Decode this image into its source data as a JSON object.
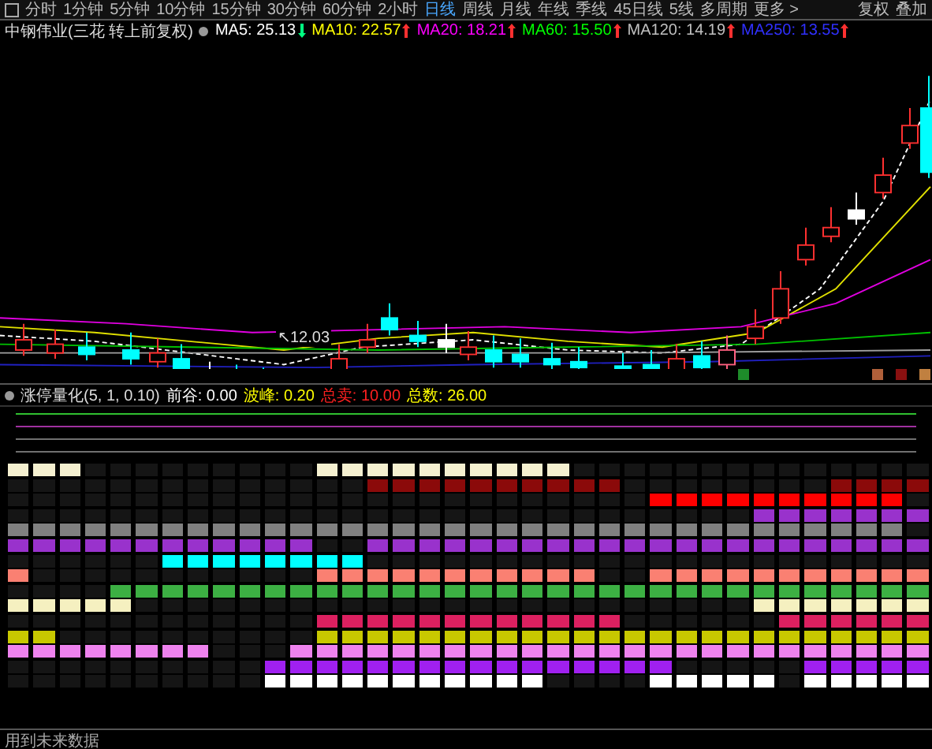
{
  "toolbar": {
    "tabs": [
      {
        "label": "分时",
        "selected": false
      },
      {
        "label": "1分钟",
        "selected": false
      },
      {
        "label": "5分钟",
        "selected": false
      },
      {
        "label": "10分钟",
        "selected": false
      },
      {
        "label": "15分钟",
        "selected": false
      },
      {
        "label": "30分钟",
        "selected": false
      },
      {
        "label": "60分钟",
        "selected": false
      },
      {
        "label": "2小时",
        "selected": false
      },
      {
        "label": "日线",
        "selected": true
      },
      {
        "label": "周线",
        "selected": false
      },
      {
        "label": "月线",
        "selected": false
      },
      {
        "label": "年线",
        "selected": false
      },
      {
        "label": "季线",
        "selected": false
      },
      {
        "label": "45日线",
        "selected": false
      },
      {
        "label": "5线",
        "selected": false
      },
      {
        "label": "多周期",
        "selected": false
      },
      {
        "label": "更多 >",
        "selected": false
      }
    ],
    "right_buttons": [
      "复权",
      "叠加"
    ]
  },
  "main_chart": {
    "title": "中钢伟业(三花 转上前复权)",
    "legend": [
      {
        "text": "MA5: 25.13",
        "color": "#ffffff",
        "arrow": {
          "kind": "down",
          "color": "#00ff80"
        }
      },
      {
        "text": "MA10: 22.57",
        "color": "#ffff00",
        "arrow": {
          "kind": "up",
          "color": "#ff3030"
        }
      },
      {
        "text": "MA20: 18.21",
        "color": "#ff00ff",
        "arrow": {
          "kind": "up",
          "color": "#ff3030"
        }
      },
      {
        "text": "MA60: 15.50",
        "color": "#00ff00",
        "arrow": {
          "kind": "up",
          "color": "#ff3030"
        }
      },
      {
        "text": "MA120: 14.19",
        "color": "#c0c0c0",
        "arrow": {
          "kind": "up",
          "color": "#ff3030"
        }
      },
      {
        "text": "MA250: 13.55",
        "color": "#3030ff",
        "arrow": {
          "kind": "up",
          "color": "#ff3030"
        }
      }
    ],
    "low_label": "↖12.03"
  },
  "indicator": {
    "title": "涨停量化(5, 1, 0.10)",
    "values": [
      {
        "text": "前谷: 0.00",
        "color": "#ffffff"
      },
      {
        "text": "波峰: 0.20",
        "color": "#ffff00"
      },
      {
        "text": "总卖: 10.00",
        "color": "#ff2020"
      },
      {
        "text": "总数: 26.00",
        "color": "#ffff00"
      }
    ],
    "rows": [
      {
        "color": "#f5f0d0",
        "cells": [
          true,
          true,
          true,
          false,
          false,
          false,
          false,
          false,
          false,
          false,
          false,
          false,
          true,
          true,
          true,
          true,
          true,
          true,
          true,
          true,
          true,
          true,
          false,
          false,
          false,
          false,
          false,
          false,
          false,
          false,
          false,
          false,
          false,
          false,
          false,
          false
        ]
      },
      {
        "color": "#8b0a0a",
        "cells": [
          false,
          false,
          false,
          false,
          false,
          false,
          false,
          false,
          false,
          false,
          false,
          false,
          false,
          false,
          true,
          true,
          true,
          true,
          true,
          true,
          true,
          true,
          true,
          true,
          false,
          false,
          false,
          false,
          false,
          false,
          false,
          false,
          true,
          true,
          true,
          true
        ]
      },
      {
        "color": "#ff0000",
        "cells": [
          false,
          false,
          false,
          false,
          false,
          false,
          false,
          false,
          false,
          false,
          false,
          false,
          false,
          false,
          false,
          false,
          false,
          false,
          false,
          false,
          false,
          false,
          false,
          false,
          false,
          true,
          true,
          true,
          true,
          true,
          true,
          true,
          true,
          true,
          true,
          false
        ]
      },
      {
        "color": "#9932cc",
        "cells": [
          false,
          false,
          false,
          false,
          false,
          false,
          false,
          false,
          false,
          false,
          false,
          false,
          false,
          false,
          false,
          false,
          false,
          false,
          false,
          false,
          false,
          false,
          false,
          false,
          false,
          false,
          false,
          false,
          false,
          true,
          true,
          true,
          true,
          true,
          true,
          true
        ]
      },
      {
        "color": "#808080",
        "cells": [
          true,
          true,
          true,
          true,
          true,
          true,
          true,
          true,
          true,
          true,
          true,
          true,
          true,
          true,
          true,
          true,
          true,
          true,
          true,
          true,
          true,
          true,
          true,
          true,
          true,
          true,
          true,
          true,
          true,
          true,
          true,
          true,
          true,
          true,
          true,
          false
        ]
      },
      {
        "color": "#9932cc",
        "cells": [
          true,
          true,
          true,
          true,
          true,
          true,
          true,
          true,
          true,
          true,
          true,
          true,
          false,
          false,
          true,
          true,
          true,
          true,
          true,
          true,
          true,
          true,
          true,
          true,
          true,
          true,
          true,
          true,
          true,
          true,
          true,
          true,
          true,
          true,
          true,
          true
        ]
      },
      {
        "color": "#00ffff",
        "cells": [
          false,
          false,
          false,
          false,
          false,
          false,
          true,
          true,
          true,
          true,
          true,
          true,
          true,
          true,
          false,
          false,
          false,
          false,
          false,
          false,
          false,
          false,
          false,
          false,
          false,
          false,
          false,
          false,
          false,
          false,
          false,
          false,
          false,
          false,
          false,
          false
        ]
      },
      {
        "color": "#fa8072",
        "cells": [
          true,
          false,
          false,
          false,
          false,
          false,
          false,
          false,
          false,
          false,
          false,
          false,
          true,
          true,
          true,
          true,
          true,
          true,
          true,
          true,
          true,
          true,
          true,
          false,
          false,
          true,
          true,
          true,
          true,
          true,
          true,
          true,
          true,
          true,
          true,
          true
        ]
      },
      {
        "color": "#3cb043",
        "cells": [
          false,
          false,
          false,
          false,
          true,
          true,
          true,
          true,
          true,
          true,
          true,
          true,
          true,
          true,
          true,
          true,
          true,
          true,
          true,
          true,
          true,
          true,
          true,
          true,
          true,
          true,
          true,
          true,
          true,
          true,
          true,
          true,
          true,
          true,
          true,
          true
        ]
      },
      {
        "color": "#f5f0c0",
        "cells": [
          true,
          true,
          true,
          true,
          true,
          false,
          false,
          false,
          false,
          false,
          false,
          false,
          false,
          false,
          false,
          false,
          false,
          false,
          false,
          false,
          false,
          false,
          false,
          false,
          false,
          false,
          false,
          false,
          false,
          true,
          true,
          true,
          true,
          true,
          true,
          true
        ]
      },
      {
        "color": "#dc2060",
        "cells": [
          false,
          false,
          false,
          false,
          false,
          false,
          false,
          false,
          false,
          false,
          false,
          false,
          true,
          true,
          true,
          true,
          true,
          true,
          true,
          true,
          true,
          true,
          true,
          true,
          false,
          false,
          false,
          false,
          false,
          false,
          true,
          true,
          true,
          true,
          true,
          true
        ]
      },
      {
        "color": "#c8c800",
        "cells": [
          true,
          true,
          false,
          false,
          false,
          false,
          false,
          false,
          false,
          false,
          false,
          false,
          true,
          true,
          true,
          true,
          true,
          true,
          true,
          true,
          true,
          true,
          true,
          true,
          true,
          true,
          true,
          true,
          true,
          true,
          true,
          true,
          true,
          true,
          true,
          true
        ]
      },
      {
        "color": "#ee82ee",
        "cells": [
          true,
          true,
          true,
          true,
          true,
          true,
          true,
          true,
          false,
          false,
          false,
          true,
          true,
          true,
          true,
          true,
          true,
          true,
          true,
          true,
          true,
          true,
          true,
          true,
          true,
          true,
          true,
          true,
          true,
          true,
          true,
          true,
          true,
          true,
          true,
          true
        ]
      },
      {
        "color": "#a020f0",
        "cells": [
          false,
          false,
          false,
          false,
          false,
          false,
          false,
          false,
          false,
          false,
          true,
          true,
          true,
          true,
          true,
          true,
          true,
          true,
          true,
          true,
          true,
          true,
          true,
          true,
          true,
          true,
          false,
          false,
          false,
          false,
          false,
          true,
          true,
          true,
          true,
          true
        ]
      },
      {
        "color": "#ffffff",
        "cells": [
          false,
          false,
          false,
          false,
          false,
          false,
          false,
          false,
          false,
          false,
          true,
          true,
          true,
          true,
          true,
          true,
          true,
          true,
          true,
          true,
          true,
          false,
          false,
          false,
          false,
          true,
          true,
          true,
          true,
          true,
          false,
          true,
          true,
          true,
          true,
          true
        ]
      }
    ]
  },
  "status_text": "用到未来数据"
}
